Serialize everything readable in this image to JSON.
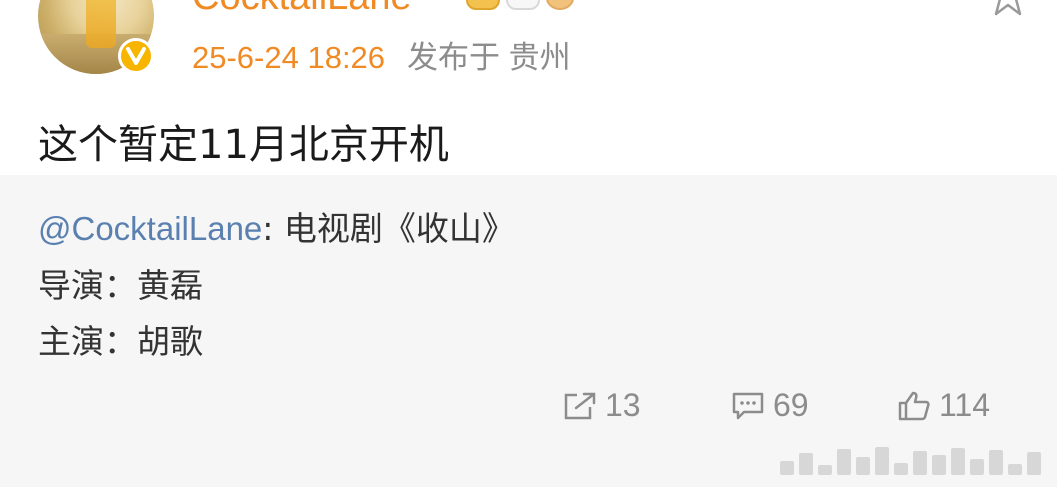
{
  "post": {
    "username": "CocktailLane",
    "timestamp": "25-6-24 18:26",
    "location": "发布于 贵州",
    "text": "这个暂定11月北京开机",
    "verified_icon": "verified-v-icon"
  },
  "repost": {
    "mention": "@CocktailLane",
    "line1_rest": ": 电视剧《收山》",
    "line2": "导演：黄磊",
    "line3": "主演：胡歌"
  },
  "actions": {
    "reposts": "13",
    "comments": "69",
    "likes": "114"
  },
  "colors": {
    "accent_orange": "#f08a24",
    "mention_blue": "#5a80b0",
    "muted_gray": "#8c8c8c",
    "card_bg": "#f6f6f6"
  }
}
